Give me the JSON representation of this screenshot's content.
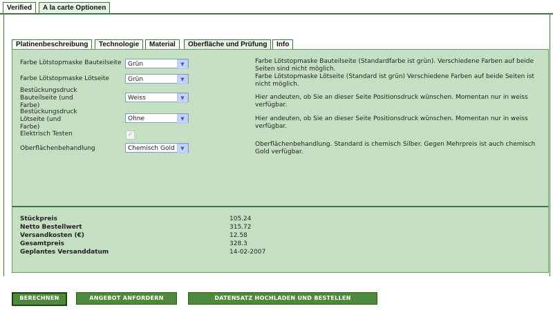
{
  "outer_tabs": [
    "Verified",
    "A la carte Optionen"
  ],
  "inner_tabs": [
    "Platinenbeschreibung",
    "Technologie",
    "Material",
    "Oberfläche und Prüfung",
    "Info"
  ],
  "fields": {
    "loetstopp_bauteil": {
      "label": "Farbe Lötstopmaske Bauteilseite",
      "value": "Grün",
      "desc": "Farbe Lötstopmaske Bauteilseite (Standardfarbe ist grün). Verschiedene Farben auf beide Seiten sind nicht möglich."
    },
    "loetstopp_loet": {
      "label": "Farbe Lötstopmaske Lötseite",
      "value": "Grün",
      "desc": "Farbe Lötstopmaske Lötseite (Standard ist grün) Verschiedene Farben auf beide Seiten ist nicht möglich."
    },
    "bestueckung_bauteil": {
      "label_line1": "Bestückungsdruck",
      "label_line2": "Bauteilseite (und",
      "label_line3": "Farbe)",
      "value": "Weiss",
      "desc": "Hier andeuten, ob Sie an dieser Seite Positionsdruck wünschen. Momentan nur in weiss verfügbar."
    },
    "bestueckung_loet": {
      "label_line1": "Bestückungsdruck",
      "label_line2": "Lötseite (und",
      "label_line3": "Farbe)",
      "value": "Ohne",
      "desc": "Hier andeuten, ob Sie an dieser Seite Positionsdruck wünschen. Momentan nur in weiss verfügbar."
    },
    "elektrisch": {
      "label": "Elektrisch Testen",
      "checked": true
    },
    "oberflaeche": {
      "label": "Oberflächenbehandlung",
      "value": "Chemisch Gold",
      "desc": "Oberflächenbehandlung. Standard is chemisch Silber. Gegen Mehrpreis ist auch chemisch Gold verfügbar."
    }
  },
  "summary": [
    {
      "label": "Stückpreis",
      "value": "105.24"
    },
    {
      "label": "Netto Bestellwert",
      "value": "315.72"
    },
    {
      "label": "Versandkosten (€)",
      "value": "12.58"
    },
    {
      "label": "Gesamtpreis",
      "value": "328.3"
    },
    {
      "label": "Geplantes Versanddatum",
      "value": "14-02-2007"
    }
  ],
  "buttons": {
    "berechnen": "BERECHNEN",
    "angebot": "ANGEBOT ANFORDERN",
    "hochladen": "DATENSATZ HOCHLADEN UND BESTELLEN"
  },
  "icons": {
    "select_arrow": "chevron-down-icon",
    "check": "checkmark-icon"
  },
  "colors": {
    "panel_bg": "#c5dfc2",
    "border_green": "#3c7a3c",
    "button_bg": "#4f8a3b"
  }
}
